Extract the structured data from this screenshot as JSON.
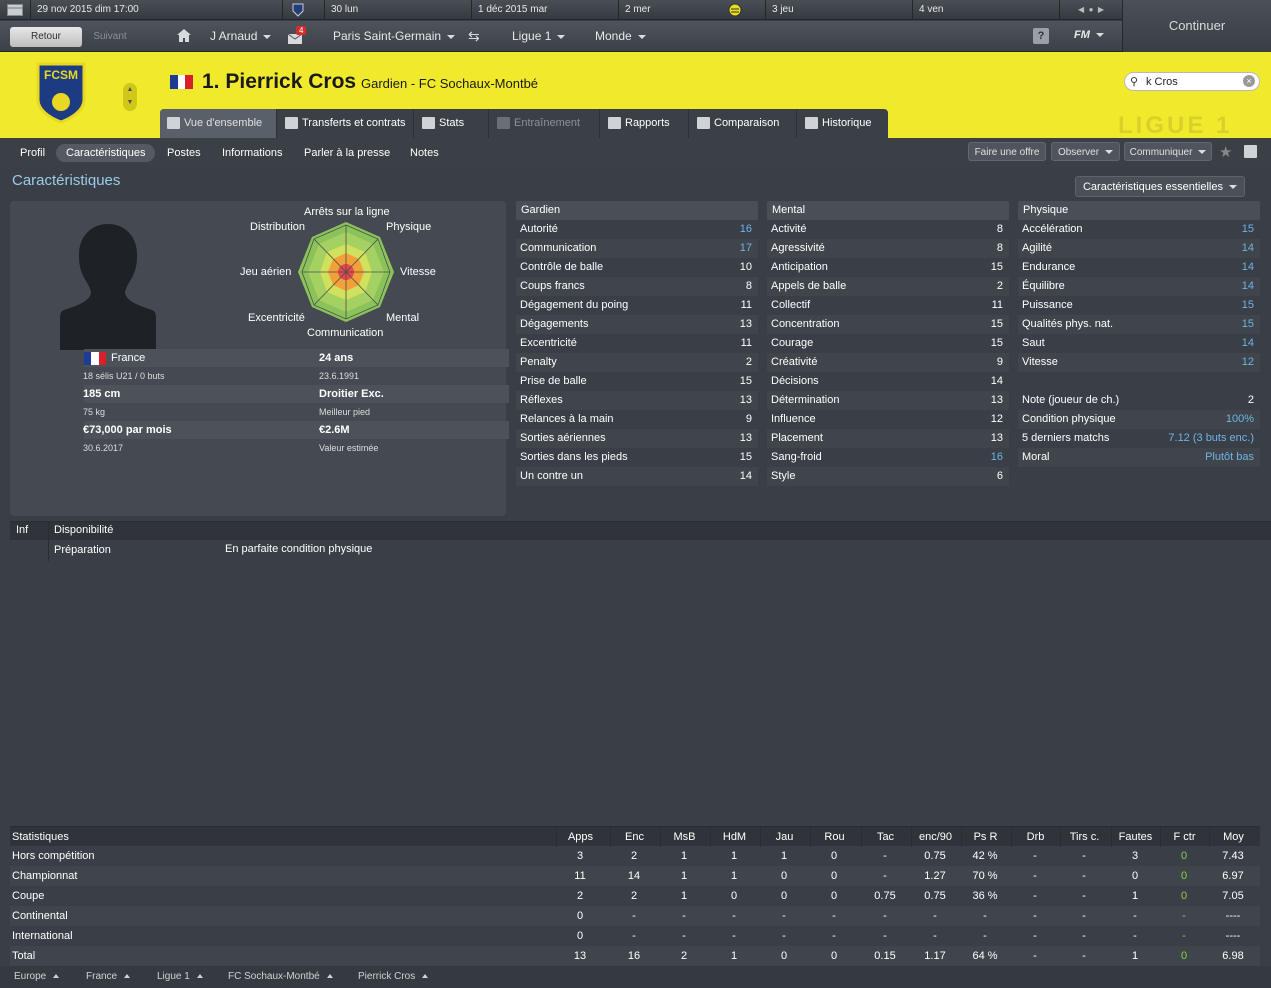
{
  "topbar": {
    "date": "29 nov 2015  dim  17:00",
    "days": [
      "30  lun",
      "1 déc 2015  mar",
      "2  mer",
      "3  jeu",
      "4  ven"
    ]
  },
  "nav": {
    "back": "Retour",
    "forward": "Suivant",
    "manager": "J Arnaud",
    "mail_count": "4",
    "club": "Paris Saint-Germain",
    "league": "Ligue 1",
    "world": "Monde",
    "help": "?",
    "fm": "FM",
    "continue": "Continuer"
  },
  "header": {
    "number_name": "1. Pierrick Cros",
    "position_club": "Gardien - FC Sochaux-Montbé",
    "crest_text": "FCSM",
    "search_value": "k Cros",
    "league_watermark": "LIGUE 1"
  },
  "tabs": [
    "Vue d'ensemble",
    "Transferts et contrats",
    "Stats",
    "Entraînement",
    "Rapports",
    "Comparaison",
    "Historique"
  ],
  "subnav": {
    "items": [
      "Profil",
      "Caractéristiques",
      "Postes",
      "Informations",
      "Parler à la presse",
      "Notes"
    ],
    "buttons": [
      "Faire une offre",
      "Observer",
      "Communiquer"
    ]
  },
  "section_title": "Caractéristiques",
  "essentials_button": "Caractéristiques essentielles",
  "radar": {
    "labels": [
      "Arrêts sur la ligne",
      "Physique",
      "Vitesse",
      "Mental",
      "Communication",
      "Excentricité",
      "Jeu aérien",
      "Distribution"
    ]
  },
  "profile": {
    "nation": "France",
    "caps": "18 sélis U21 / 0 buts",
    "height": "185 cm",
    "weight": "75 kg",
    "wage": "€73,000 par mois",
    "contract_end": "30.6.2017",
    "age": "24 ans",
    "dob": "23.6.1991",
    "foot": "Droitier Exc.",
    "foot_label": "Meilleur pied",
    "value": "€2.6M",
    "value_label": "Valeur estimée"
  },
  "attributes": {
    "goalkeeper": {
      "title": "Gardien",
      "rows": [
        [
          "Autorité",
          "16"
        ],
        [
          "Communication",
          "17"
        ],
        [
          "Contrôle de balle",
          "10"
        ],
        [
          "Coups francs",
          "8"
        ],
        [
          "Dégagement du poing",
          "11"
        ],
        [
          "Dégagements",
          "13"
        ],
        [
          "Excentricité",
          "11"
        ],
        [
          "Penalty",
          "2"
        ],
        [
          "Prise de balle",
          "15"
        ],
        [
          "Réflexes",
          "13"
        ],
        [
          "Relances à la main",
          "9"
        ],
        [
          "Sorties aériennes",
          "13"
        ],
        [
          "Sorties dans les pieds",
          "15"
        ],
        [
          "Un contre un",
          "14"
        ]
      ]
    },
    "mental": {
      "title": "Mental",
      "rows": [
        [
          "Activité",
          "8"
        ],
        [
          "Agressivité",
          "8"
        ],
        [
          "Anticipation",
          "15"
        ],
        [
          "Appels de balle",
          "2"
        ],
        [
          "Collectif",
          "11"
        ],
        [
          "Concentration",
          "15"
        ],
        [
          "Courage",
          "15"
        ],
        [
          "Créativité",
          "9"
        ],
        [
          "Décisions",
          "14"
        ],
        [
          "Détermination",
          "13"
        ],
        [
          "Influence",
          "12"
        ],
        [
          "Placement",
          "13"
        ],
        [
          "Sang-froid",
          "16"
        ],
        [
          "Style",
          "6"
        ]
      ]
    },
    "physical": {
      "title": "Physique",
      "rows": [
        [
          "Accélération",
          "15"
        ],
        [
          "Agilité",
          "14"
        ],
        [
          "Endurance",
          "14"
        ],
        [
          "Équilibre",
          "14"
        ],
        [
          "Puissance",
          "15"
        ],
        [
          "Qualités phys. nat.",
          "15"
        ],
        [
          "Saut",
          "14"
        ],
        [
          "Vitesse",
          "12"
        ]
      ]
    },
    "extra": [
      [
        "Note (joueur de ch.)",
        "2"
      ],
      [
        "Condition physique",
        "100%"
      ],
      [
        "5 derniers matchs",
        "7.12 (3 buts enc.)"
      ],
      [
        "Moral",
        "Plutôt bas"
      ]
    ]
  },
  "info": {
    "tab": "Inf",
    "title": "Disponibilité",
    "label": "Préparation",
    "value": "En parfaite condition physique"
  },
  "stats": {
    "headers": [
      "Statistiques",
      "Apps",
      "Enc",
      "MsB",
      "HdM",
      "Jau",
      "Rou",
      "Tac",
      "enc/90",
      "Ps R",
      "Drb",
      "Tirs c.",
      "Fautes",
      "F ctr",
      "Moy"
    ],
    "rows": [
      [
        "Hors compétition",
        "3",
        "2",
        "1",
        "1",
        "1",
        "0",
        "-",
        "0.75",
        "42 %",
        "-",
        "-",
        "3",
        "0",
        "7.43"
      ],
      [
        "Championnat",
        "11",
        "14",
        "1",
        "1",
        "0",
        "0",
        "-",
        "1.27",
        "70 %",
        "-",
        "-",
        "0",
        "0",
        "6.97"
      ],
      [
        "Coupe",
        "2",
        "2",
        "1",
        "0",
        "0",
        "0",
        "0.75",
        "0.75",
        "36 %",
        "-",
        "-",
        "1",
        "0",
        "7.05"
      ],
      [
        "Continental",
        "0",
        "-",
        "-",
        "-",
        "-",
        "-",
        "-",
        "-",
        "-",
        "-",
        "-",
        "-",
        "-",
        "----"
      ],
      [
        "International",
        "0",
        "-",
        "-",
        "-",
        "-",
        "-",
        "-",
        "-",
        "-",
        "-",
        "-",
        "-",
        "-",
        "----"
      ],
      [
        "Total",
        "13",
        "16",
        "2",
        "1",
        "0",
        "0",
        "0.15",
        "1.17",
        "64 %",
        "-",
        "-",
        "1",
        "0",
        "6.98"
      ]
    ]
  },
  "footer": [
    "Europe",
    "France",
    "Ligue 1",
    "FC Sochaux-Montbé",
    "Pierrick Cros"
  ]
}
